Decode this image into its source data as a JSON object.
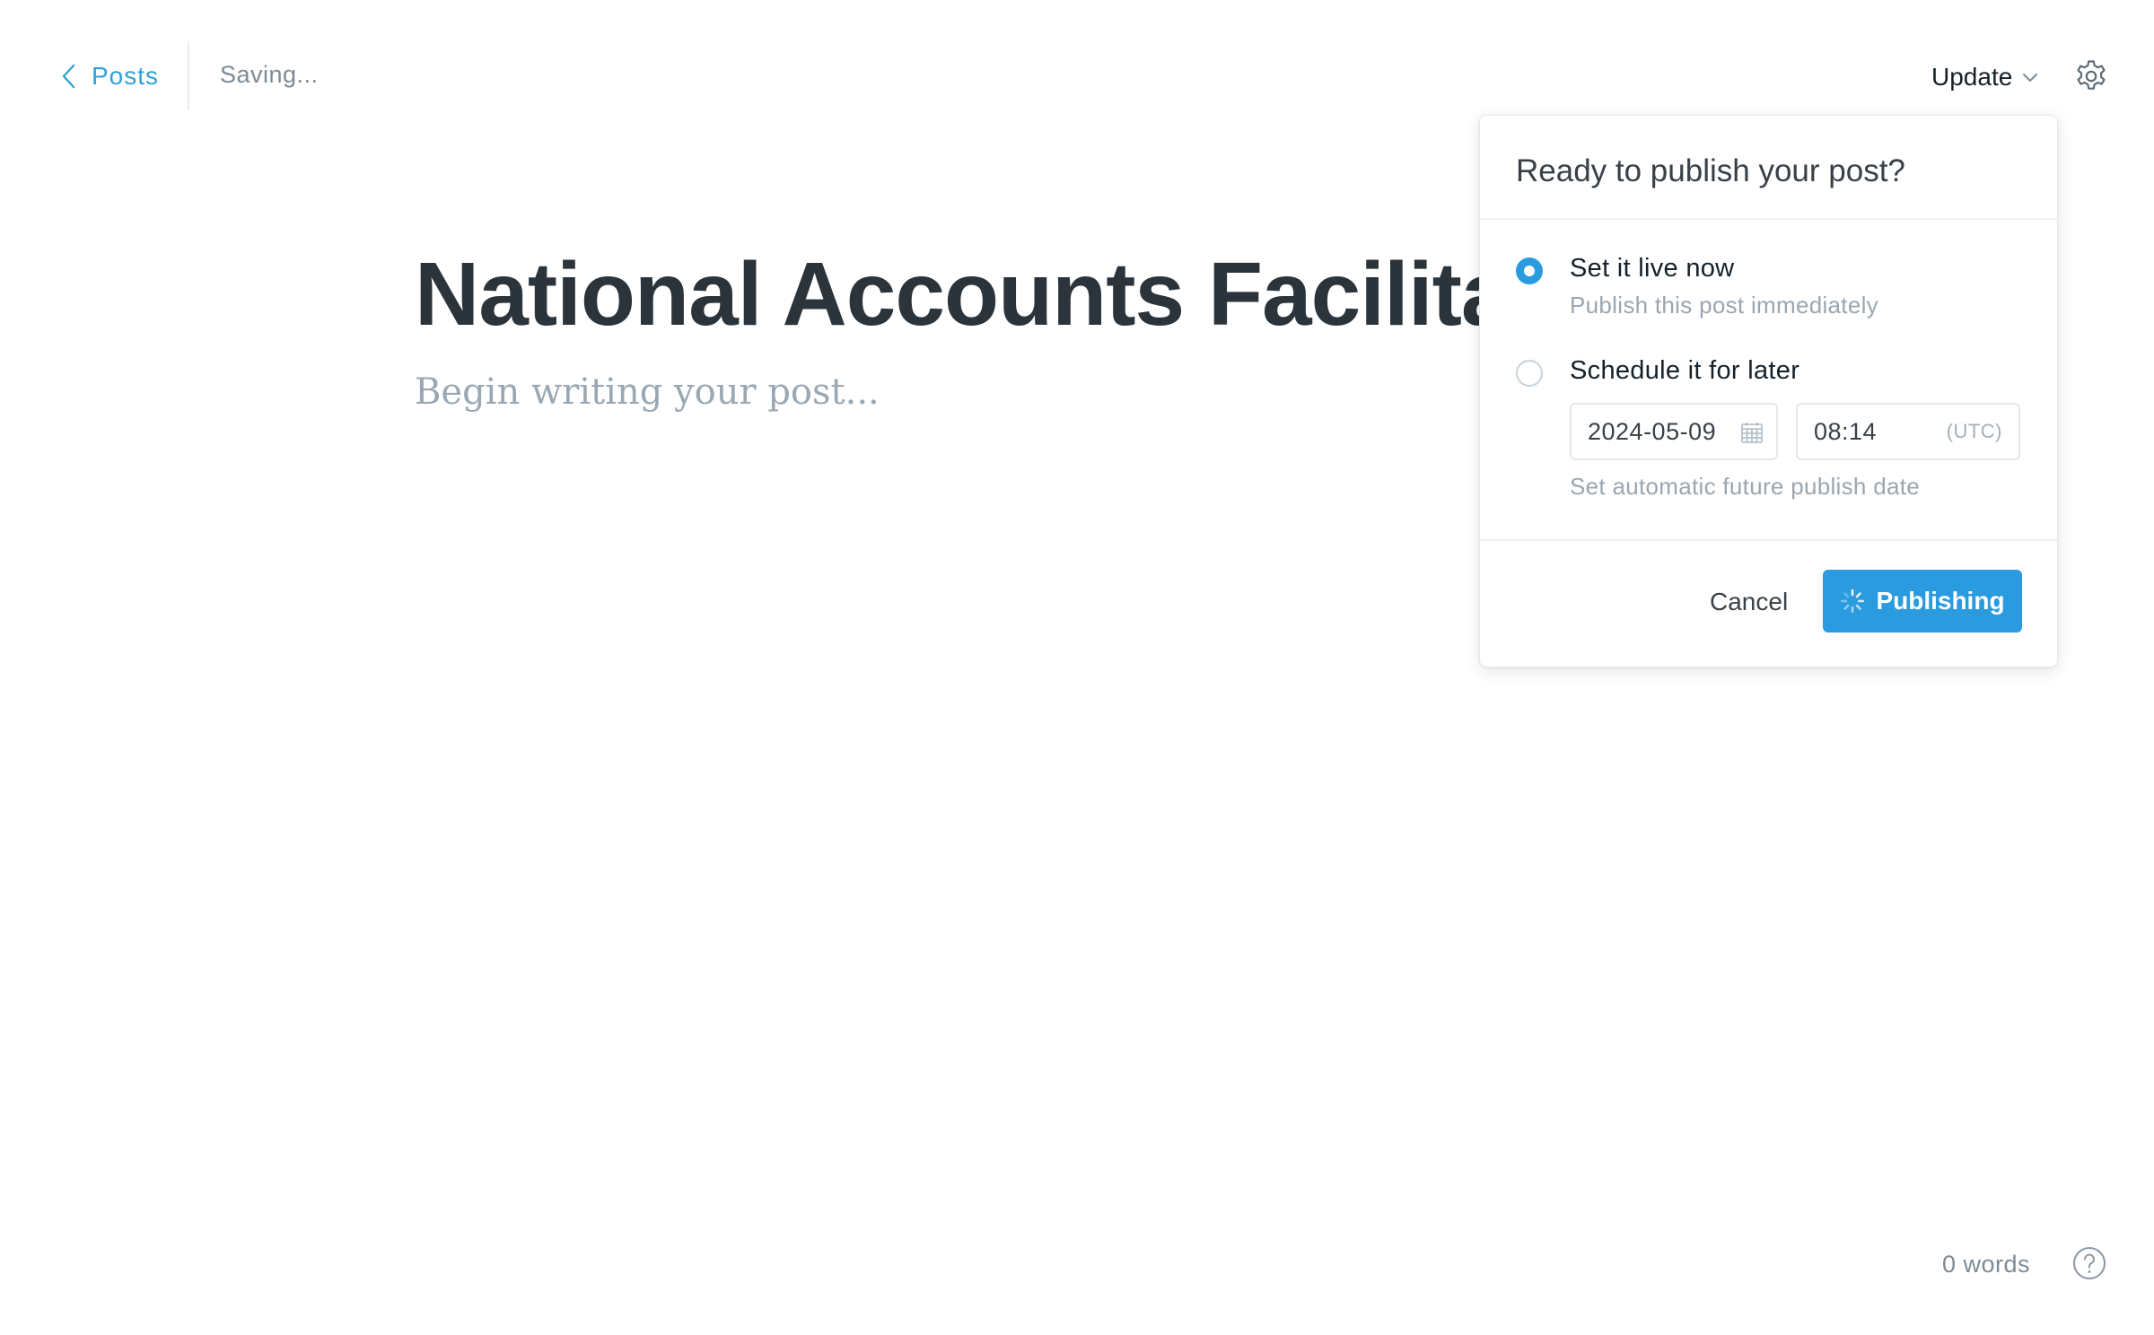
{
  "topbar": {
    "back_label": "Posts",
    "status": "Saving...",
    "update_label": "Update",
    "back_icon": "chevron-left-icon",
    "update_icon": "chevron-down-icon",
    "settings_icon": "gear-icon"
  },
  "editor": {
    "title": "National Accounts Facilitato",
    "body_placeholder": "Begin writing your post..."
  },
  "publish_menu": {
    "title": "Ready to publish your post?",
    "options": [
      {
        "label": "Set it live now",
        "description": "Publish this post immediately",
        "selected": true
      },
      {
        "label": "Schedule it for later",
        "selected": false
      }
    ],
    "schedule": {
      "date": "2024-05-09",
      "time": "08:14",
      "timezone": "(UTC)",
      "hint": "Set automatic future publish date"
    },
    "cancel_label": "Cancel",
    "publish_label": "Publishing"
  },
  "footer": {
    "word_count": "0 words",
    "help_icon": "question-circle-icon"
  },
  "colors": {
    "accent": "#2b9be0",
    "link": "#30a0d8",
    "title_text": "#2b343a",
    "muted_text": "#7d8b96"
  }
}
